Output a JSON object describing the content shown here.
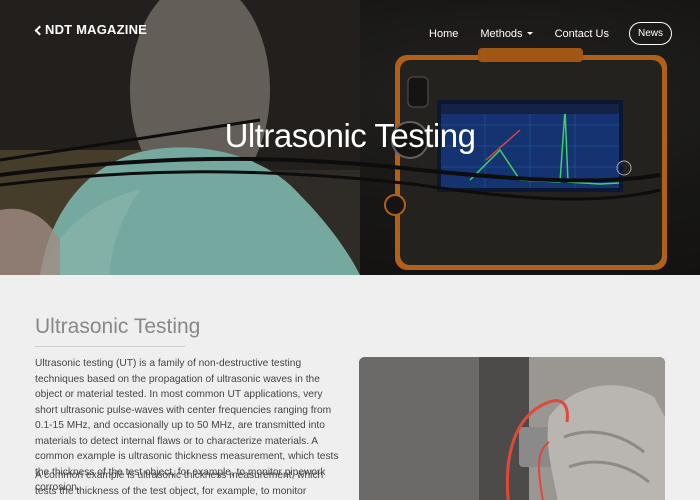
{
  "brand": {
    "label": "NDT MAGAZINE"
  },
  "nav": {
    "home": "Home",
    "methods": "Methods",
    "contact": "Contact Us",
    "news": "News"
  },
  "hero": {
    "title": "Ultrasonic Testing"
  },
  "section": {
    "title": "Ultrasonic Testing",
    "paragraph1": "Ultrasonic testing (UT) is a family of non-destructive testing techniques based on the propagation of ultrasonic waves in the object or material tested. In most common UT applications, very short ultrasonic pulse-waves with center frequencies ranging from 0.1-15 MHz, and occasionally up to 50 MHz, are transmitted into materials to detect internal flaws or to characterize materials. A common example is ultrasonic thickness measurement, which tests the thickness of the test object, for example, to monitor pipework corrosion.",
    "paragraph2": "A common example is ultrasonic thickness measurement, which tests the thickness of the test object, for example, to monitor pipework corrosion."
  },
  "colors": {
    "device_orange": "#d9761e",
    "screen_blue": "#1a3d8a",
    "glove": "#8fcfc4"
  }
}
